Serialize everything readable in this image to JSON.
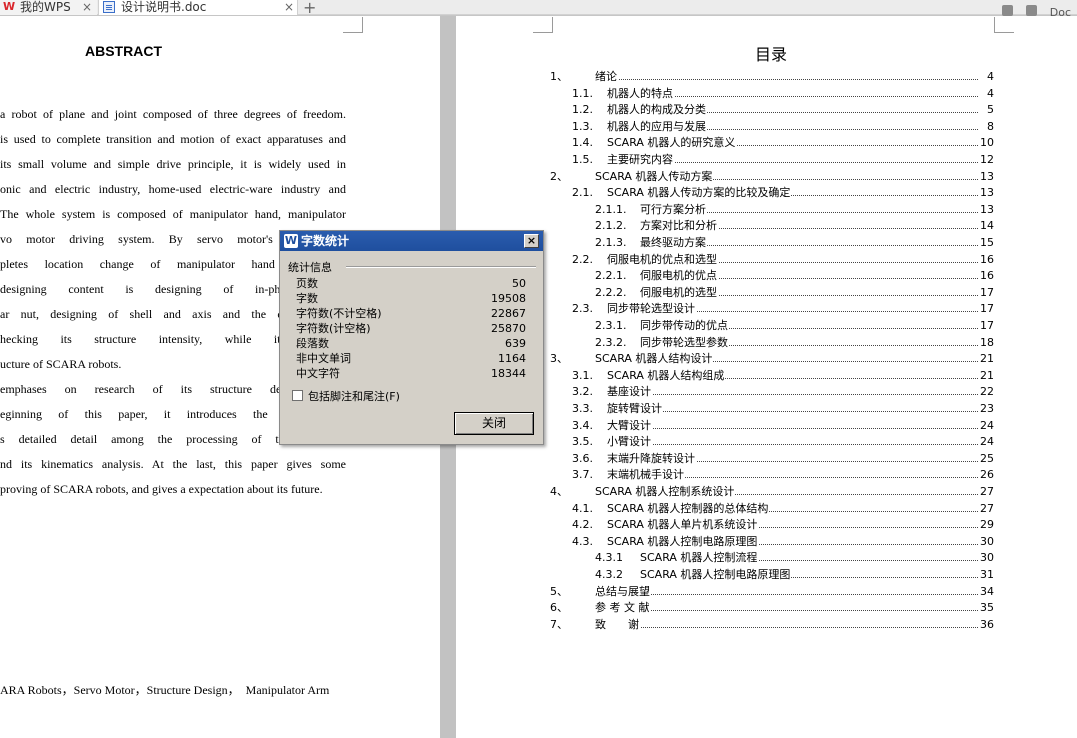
{
  "tabs": {
    "wps_label": "我的WPS",
    "doc_label": "设计说明书.doc",
    "close_glyph": "×",
    "new_glyph": "+",
    "right_label": "Doc"
  },
  "abstract": {
    "title": "ABSTRACT",
    "lines": [
      "a robot of plane and joint composed of three degrees of freedom.",
      "is used to complete transition and motion of exact apparatuses and",
      "its small volume and simple drive principle, it is widely used in",
      "onic and electric industry, home-used electric-ware industry and",
      "The whole system is composed of manipulator hand, manipulator",
      "vo motor driving system. By servo motor's driving of",
      "pletes location change of manipulator hand and man",
      "designing content is designing of in-phase tooth-",
      "ar nut, designing of shell and axis and the choice of s",
      "hecking its structure intensity, while it satisfied,",
      "ucture of SCARA robots.",
      "emphases on research of its structure designing an",
      "eginning of this paper, it introduces the development",
      "s detailed detail among the processing of the structure",
      "nd its kinematics analysis. At the last, this paper gives some",
      "proving of SCARA robots, and gives a expectation about its future."
    ],
    "keywords": "ARA Robots，Servo Motor，Structure Design，  Manipulator Arm"
  },
  "toc": {
    "title": "目录",
    "entries": [
      {
        "num": "1、",
        "text": "绪论",
        "page": "4",
        "level": 1
      },
      {
        "num": "1.1.",
        "text": "机器人的特点",
        "page": "4",
        "level": 2
      },
      {
        "num": "1.2.",
        "text": "机器人的构成及分类",
        "page": "5",
        "level": 2
      },
      {
        "num": "1.3.",
        "text": "机器人的应用与发展",
        "page": "8",
        "level": 2
      },
      {
        "num": "1.4.",
        "text": "SCARA 机器人的研究意义",
        "page": "10",
        "level": 2
      },
      {
        "num": "1.5.",
        "text": "主要研究内容",
        "page": "12",
        "level": 2
      },
      {
        "num": "2、",
        "text": "SCARA 机器人传动方案",
        "page": "13",
        "level": 1
      },
      {
        "num": "2.1.",
        "text": "SCARA 机器人传动方案的比较及确定",
        "page": "13",
        "level": 2
      },
      {
        "num": "2.1.1.",
        "text": "可行方案分析",
        "page": "13",
        "level": 3
      },
      {
        "num": "2.1.2.",
        "text": "方案对比和分析",
        "page": "14",
        "level": 3
      },
      {
        "num": "2.1.3.",
        "text": "最终驱动方案",
        "page": "15",
        "level": 3
      },
      {
        "num": "2.2.",
        "text": "伺服电机的优点和选型",
        "page": "16",
        "level": 2
      },
      {
        "num": "2.2.1.",
        "text": "伺服电机的优点",
        "page": "16",
        "level": 3
      },
      {
        "num": "2.2.2.",
        "text": "伺服电机的选型",
        "page": "17",
        "level": 3
      },
      {
        "num": "2.3.",
        "text": "同步带轮选型设计",
        "page": "17",
        "level": 2
      },
      {
        "num": "2.3.1.",
        "text": "同步带传动的优点",
        "page": "17",
        "level": 3
      },
      {
        "num": "2.3.2.",
        "text": "同步带轮选型参数",
        "page": "18",
        "level": 3
      },
      {
        "num": "3、",
        "text": "SCARA 机器人结构设计",
        "page": "21",
        "level": 1
      },
      {
        "num": "3.1.",
        "text": "SCARA 机器人结构组成",
        "page": "21",
        "level": 2
      },
      {
        "num": "3.2.",
        "text": "基座设计",
        "page": "22",
        "level": 2
      },
      {
        "num": "3.3.",
        "text": "旋转臂设计",
        "page": "23",
        "level": 2
      },
      {
        "num": "3.4.",
        "text": "大臂设计",
        "page": "24",
        "level": 2
      },
      {
        "num": "3.5.",
        "text": "小臂设计",
        "page": "24",
        "level": 2
      },
      {
        "num": "3.6.",
        "text": "末端升降旋转设计",
        "page": "25",
        "level": 2
      },
      {
        "num": "3.7.",
        "text": "末端机械手设计",
        "page": "26",
        "level": 2
      },
      {
        "num": "4、",
        "text": "SCARA 机器人控制系统设计",
        "page": "27",
        "level": 1
      },
      {
        "num": "4.1.",
        "text": "SCARA 机器人控制器的总体结构",
        "page": "27",
        "level": 2
      },
      {
        "num": "4.2.",
        "text": "SCARA 机器人单片机系统设计",
        "page": "29",
        "level": 2
      },
      {
        "num": "4.3.",
        "text": "SCARA 机器人控制电路原理图",
        "page": "30",
        "level": 2
      },
      {
        "num": "4.3.1",
        "text": "SCARA 机器人控制流程",
        "page": "30",
        "level": 3
      },
      {
        "num": "4.3.2",
        "text": "SCARA 机器人控制电路原理图",
        "page": "31",
        "level": 3
      },
      {
        "num": "5、",
        "text": "总结与展望",
        "page": "34",
        "level": 1
      },
      {
        "num": "6、",
        "text": "参 考 文 献",
        "page": "35",
        "level": 1
      },
      {
        "num": "7、",
        "text": "致　　谢",
        "page": "36",
        "level": 1
      }
    ]
  },
  "dialog": {
    "title": "字数统计",
    "close_x": "×",
    "group_label": "统计信息",
    "stats": [
      {
        "label": "页数",
        "value": "50"
      },
      {
        "label": "字数",
        "value": "19508"
      },
      {
        "label": "字符数(不计空格)",
        "value": "22867"
      },
      {
        "label": "字符数(计空格)",
        "value": "25870"
      },
      {
        "label": "段落数",
        "value": "639"
      },
      {
        "label": "非中文单词",
        "value": "1164"
      },
      {
        "label": "中文字符",
        "value": "18344"
      }
    ],
    "checkbox_label": "包括脚注和尾注(F)",
    "close_button": "关闭"
  }
}
